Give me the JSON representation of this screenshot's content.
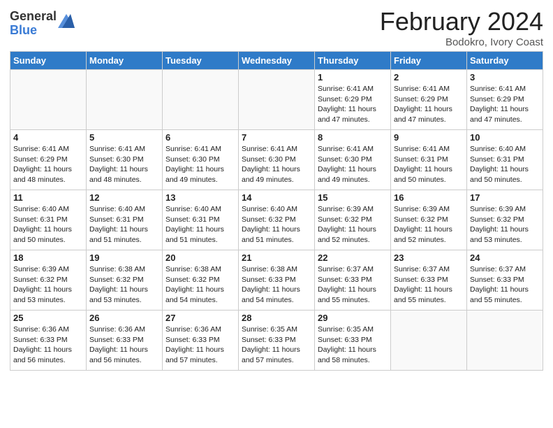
{
  "logo": {
    "general": "General",
    "blue": "Blue"
  },
  "title": "February 2024",
  "subtitle": "Bodokro, Ivory Coast",
  "days_of_week": [
    "Sunday",
    "Monday",
    "Tuesday",
    "Wednesday",
    "Thursday",
    "Friday",
    "Saturday"
  ],
  "weeks": [
    [
      {
        "day": "",
        "info": ""
      },
      {
        "day": "",
        "info": ""
      },
      {
        "day": "",
        "info": ""
      },
      {
        "day": "",
        "info": ""
      },
      {
        "day": "1",
        "info": "Sunrise: 6:41 AM\nSunset: 6:29 PM\nDaylight: 11 hours and 47 minutes."
      },
      {
        "day": "2",
        "info": "Sunrise: 6:41 AM\nSunset: 6:29 PM\nDaylight: 11 hours and 47 minutes."
      },
      {
        "day": "3",
        "info": "Sunrise: 6:41 AM\nSunset: 6:29 PM\nDaylight: 11 hours and 47 minutes."
      }
    ],
    [
      {
        "day": "4",
        "info": "Sunrise: 6:41 AM\nSunset: 6:29 PM\nDaylight: 11 hours and 48 minutes."
      },
      {
        "day": "5",
        "info": "Sunrise: 6:41 AM\nSunset: 6:30 PM\nDaylight: 11 hours and 48 minutes."
      },
      {
        "day": "6",
        "info": "Sunrise: 6:41 AM\nSunset: 6:30 PM\nDaylight: 11 hours and 49 minutes."
      },
      {
        "day": "7",
        "info": "Sunrise: 6:41 AM\nSunset: 6:30 PM\nDaylight: 11 hours and 49 minutes."
      },
      {
        "day": "8",
        "info": "Sunrise: 6:41 AM\nSunset: 6:30 PM\nDaylight: 11 hours and 49 minutes."
      },
      {
        "day": "9",
        "info": "Sunrise: 6:41 AM\nSunset: 6:31 PM\nDaylight: 11 hours and 50 minutes."
      },
      {
        "day": "10",
        "info": "Sunrise: 6:40 AM\nSunset: 6:31 PM\nDaylight: 11 hours and 50 minutes."
      }
    ],
    [
      {
        "day": "11",
        "info": "Sunrise: 6:40 AM\nSunset: 6:31 PM\nDaylight: 11 hours and 50 minutes."
      },
      {
        "day": "12",
        "info": "Sunrise: 6:40 AM\nSunset: 6:31 PM\nDaylight: 11 hours and 51 minutes."
      },
      {
        "day": "13",
        "info": "Sunrise: 6:40 AM\nSunset: 6:31 PM\nDaylight: 11 hours and 51 minutes."
      },
      {
        "day": "14",
        "info": "Sunrise: 6:40 AM\nSunset: 6:32 PM\nDaylight: 11 hours and 51 minutes."
      },
      {
        "day": "15",
        "info": "Sunrise: 6:39 AM\nSunset: 6:32 PM\nDaylight: 11 hours and 52 minutes."
      },
      {
        "day": "16",
        "info": "Sunrise: 6:39 AM\nSunset: 6:32 PM\nDaylight: 11 hours and 52 minutes."
      },
      {
        "day": "17",
        "info": "Sunrise: 6:39 AM\nSunset: 6:32 PM\nDaylight: 11 hours and 53 minutes."
      }
    ],
    [
      {
        "day": "18",
        "info": "Sunrise: 6:39 AM\nSunset: 6:32 PM\nDaylight: 11 hours and 53 minutes."
      },
      {
        "day": "19",
        "info": "Sunrise: 6:38 AM\nSunset: 6:32 PM\nDaylight: 11 hours and 53 minutes."
      },
      {
        "day": "20",
        "info": "Sunrise: 6:38 AM\nSunset: 6:32 PM\nDaylight: 11 hours and 54 minutes."
      },
      {
        "day": "21",
        "info": "Sunrise: 6:38 AM\nSunset: 6:33 PM\nDaylight: 11 hours and 54 minutes."
      },
      {
        "day": "22",
        "info": "Sunrise: 6:37 AM\nSunset: 6:33 PM\nDaylight: 11 hours and 55 minutes."
      },
      {
        "day": "23",
        "info": "Sunrise: 6:37 AM\nSunset: 6:33 PM\nDaylight: 11 hours and 55 minutes."
      },
      {
        "day": "24",
        "info": "Sunrise: 6:37 AM\nSunset: 6:33 PM\nDaylight: 11 hours and 55 minutes."
      }
    ],
    [
      {
        "day": "25",
        "info": "Sunrise: 6:36 AM\nSunset: 6:33 PM\nDaylight: 11 hours and 56 minutes."
      },
      {
        "day": "26",
        "info": "Sunrise: 6:36 AM\nSunset: 6:33 PM\nDaylight: 11 hours and 56 minutes."
      },
      {
        "day": "27",
        "info": "Sunrise: 6:36 AM\nSunset: 6:33 PM\nDaylight: 11 hours and 57 minutes."
      },
      {
        "day": "28",
        "info": "Sunrise: 6:35 AM\nSunset: 6:33 PM\nDaylight: 11 hours and 57 minutes."
      },
      {
        "day": "29",
        "info": "Sunrise: 6:35 AM\nSunset: 6:33 PM\nDaylight: 11 hours and 58 minutes."
      },
      {
        "day": "",
        "info": ""
      },
      {
        "day": "",
        "info": ""
      }
    ]
  ]
}
